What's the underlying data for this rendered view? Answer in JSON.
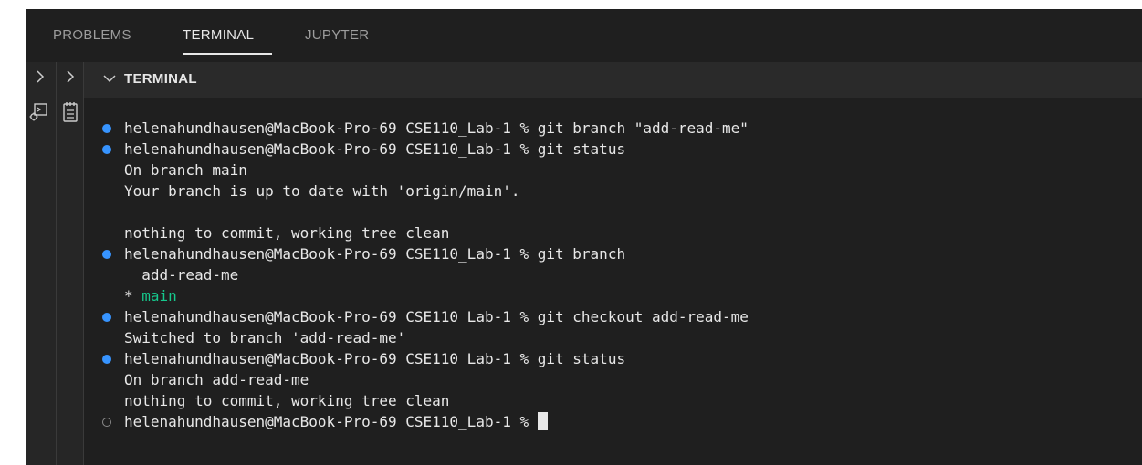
{
  "tabs": [
    {
      "label": "PROBLEMS"
    },
    {
      "label": "TERMINAL"
    },
    {
      "label": "JUPYTER"
    }
  ],
  "section": {
    "title": "TERMINAL"
  },
  "terminal": {
    "lines": [
      {
        "prompt": "helenahundhausen@MacBook-Pro-69 CSE110_Lab-1 % ",
        "command": "git branch \"add-read-me\""
      },
      {
        "prompt": "helenahundhausen@MacBook-Pro-69 CSE110_Lab-1 % ",
        "command": "git status"
      },
      {
        "text": "On branch main"
      },
      {
        "text": "Your branch is up to date with 'origin/main'."
      },
      {
        "text": ""
      },
      {
        "text": "nothing to commit, working tree clean"
      },
      {
        "prompt": "helenahundhausen@MacBook-Pro-69 CSE110_Lab-1 % ",
        "command": "git branch"
      },
      {
        "text": "  add-read-me"
      },
      {
        "marker": "* ",
        "branch": "main"
      },
      {
        "prompt": "helenahundhausen@MacBook-Pro-69 CSE110_Lab-1 % ",
        "command": "git checkout add-read-me"
      },
      {
        "text": "Switched to branch 'add-read-me'"
      },
      {
        "prompt": "helenahundhausen@MacBook-Pro-69 CSE110_Lab-1 % ",
        "command": "git status"
      },
      {
        "text": "On branch add-read-me"
      },
      {
        "text": "nothing to commit, working tree clean"
      },
      {
        "prompt": "helenahundhausen@MacBook-Pro-69 CSE110_Lab-1 % "
      }
    ]
  },
  "colors": {
    "background": "#1f1f1f",
    "success_dot": "#3794ff",
    "current_branch": "#16c98d",
    "text": "#e8e8e8"
  }
}
